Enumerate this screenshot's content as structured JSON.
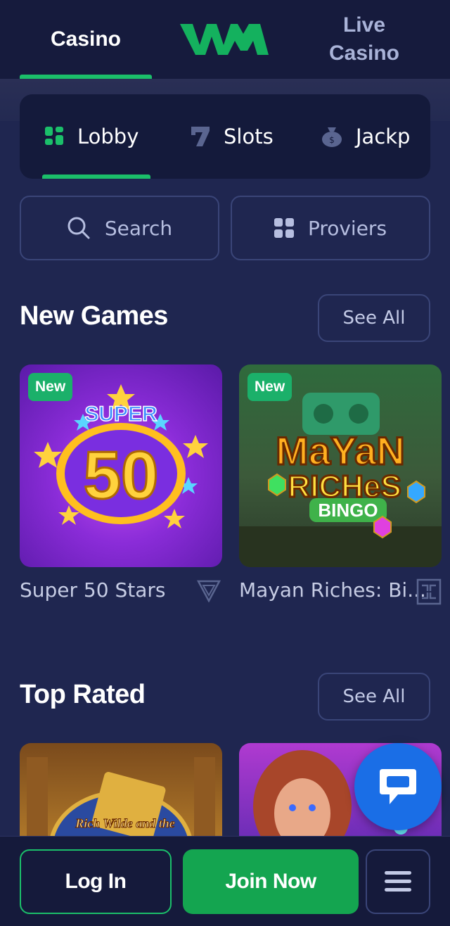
{
  "header": {
    "tab_casino": "Casino",
    "tab_live_line1": "Live",
    "tab_live_line2": "Casino",
    "logo_text": "WM",
    "brand_color": "#1bbf6a"
  },
  "categories": [
    {
      "label": "Lobby",
      "icon": "grid-icon"
    },
    {
      "label": "Slots",
      "icon": "seven-icon"
    },
    {
      "label": "Jackp",
      "icon": "money-bag-icon"
    }
  ],
  "search": {
    "label": "Search"
  },
  "providers": {
    "label": "Proviers"
  },
  "sections": {
    "new_games": {
      "title": "New Games",
      "see_all": "See All",
      "games": [
        {
          "name": "Super 50 Stars",
          "badge": "New",
          "art_text_top": "SUPER",
          "art_text_main": "50"
        },
        {
          "name": "Mayan Riches: Bi...",
          "badge": "New",
          "art_text_top": "MaYaN",
          "art_text_main": "RICHeS",
          "art_text_sub": "BINGO"
        }
      ]
    },
    "top_rated": {
      "title": "Top Rated",
      "see_all": "See All",
      "games": [
        {
          "art_text": "Rich Wilde and the"
        },
        {}
      ]
    }
  },
  "bottom_bar": {
    "login": "Log In",
    "join": "Join Now"
  }
}
